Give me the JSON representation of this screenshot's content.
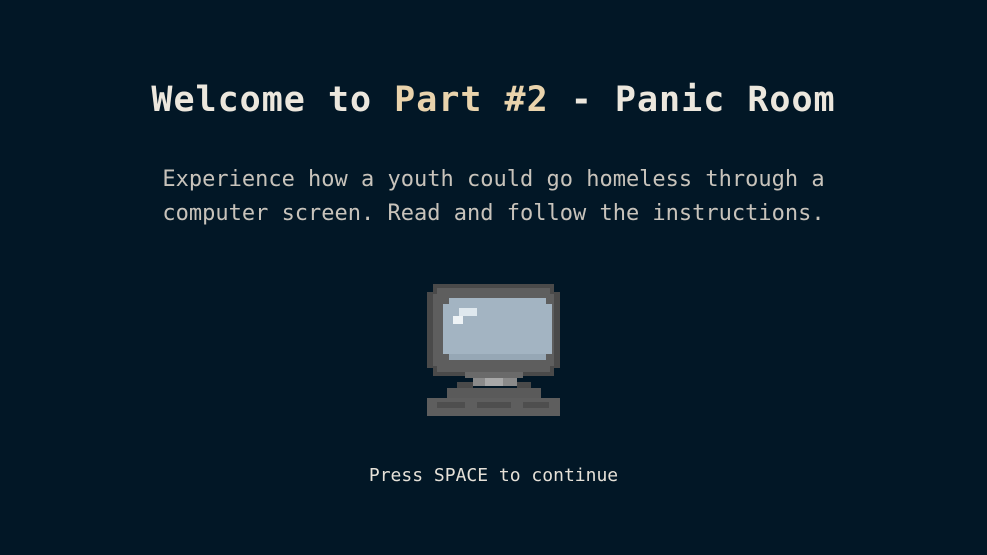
{
  "title": {
    "prefix": "Welcome to ",
    "highlight": "Part #2",
    "suffix": " - Panic Room",
    "text_color": "#ece7dd",
    "highlight_color": "#e9d3ac"
  },
  "description": {
    "line1": "Experience how a youth could go homeless through a",
    "line2": "computer screen. Read and follow the instructions."
  },
  "illustration": {
    "icon": "computer-monitor-icon"
  },
  "prompt": {
    "text": "Press SPACE to continue"
  },
  "colors": {
    "background": "#021726"
  }
}
